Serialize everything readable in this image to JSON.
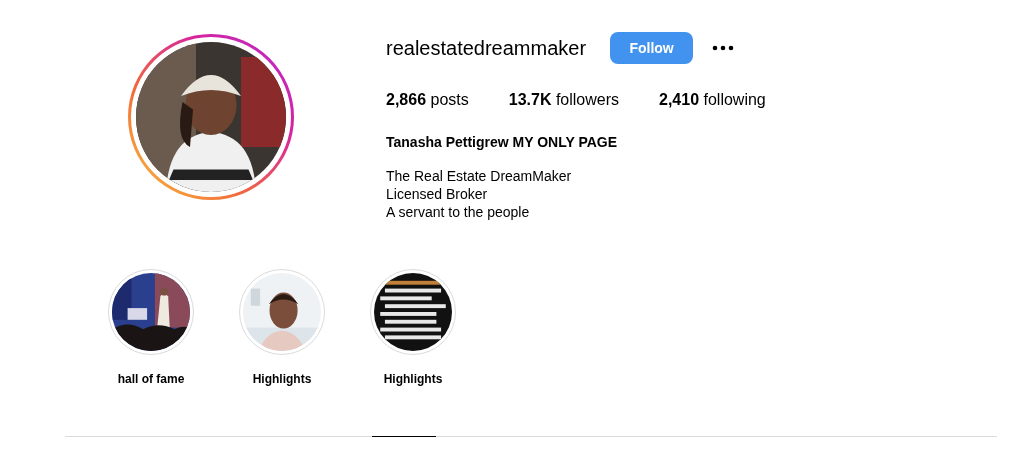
{
  "profile": {
    "username": "realestatedreammaker",
    "follow_button": "Follow",
    "stats": [
      "**2,866** posts",
      "**13.7K** followers",
      "**2,410** following"
    ],
    "full_name": "Tanasha Pettigrew MY ONLY PAGE",
    "bio": [
      "The Real Estate DreamMaker",
      "Licensed Broker",
      "A servant to the people"
    ]
  },
  "highlights": [
    {
      "label": "hall of fame",
      "kind": "picture"
    },
    {
      "label": "Highlights",
      "kind": "picture"
    },
    {
      "label": "Highlights",
      "kind": "picture"
    }
  ]
}
